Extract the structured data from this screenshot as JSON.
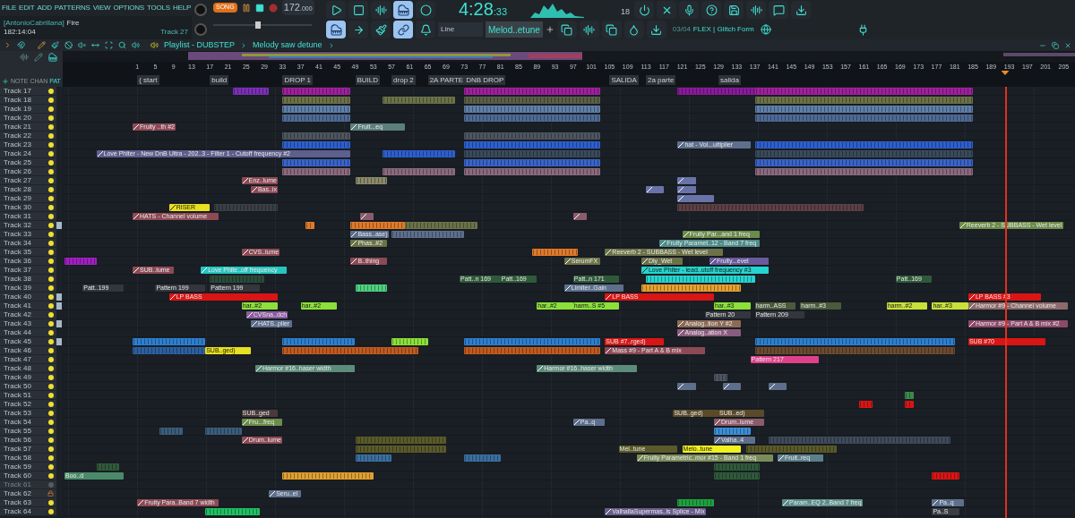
{
  "menu": [
    "FILE",
    "EDIT",
    "ADD",
    "PATTERNS",
    "VIEW",
    "OPTIONS",
    "TOOLS",
    "HELP"
  ],
  "transport": {
    "mode": "SONG",
    "recording": false,
    "tempo": "172",
    "tempo_fraction": ".000",
    "time": "4:28",
    "time_fraction": ":33",
    "voices": "18"
  },
  "pitch": {
    "level": 0.45
  },
  "hint": {
    "user": "[AntonioCabrillana]",
    "title": "Fire",
    "position": "182:14:04",
    "track": "Track 27"
  },
  "tools": [
    {
      "kind": "piano",
      "selected": true
    },
    {
      "kind": "arrow",
      "selected": false
    },
    {
      "kind": "brush",
      "selected": false
    },
    {
      "kind": "link",
      "selected": true
    },
    {
      "kind": "bell",
      "selected": false
    }
  ],
  "snap": "Line",
  "pattern": "Melod..etune",
  "news": {
    "counter": "03/04",
    "text": "FLEX | Glitch Form"
  },
  "playlist": {
    "title": "Playlist - DUBSTEP",
    "pattern": "Melody saw detune"
  },
  "view_tabs": [
    {
      "label": "NOTE",
      "selected": false
    },
    {
      "label": "CHAN",
      "selected": false
    },
    {
      "label": "PAT",
      "selected": true
    }
  ],
  "ruler": [
    "1",
    "5",
    "9",
    "13",
    "17",
    "21",
    "25",
    "29",
    "33",
    "37",
    "41",
    "45",
    "49",
    "53",
    "57",
    "61",
    "65",
    "69",
    "73",
    "77",
    "81",
    "85",
    "89",
    "93",
    "97",
    "101",
    "105",
    "109",
    "113",
    "117",
    "121",
    "125",
    "129",
    "133",
    "137",
    "141",
    "145",
    "149",
    "153",
    "157",
    "161",
    "165",
    "169",
    "173",
    "177",
    "181",
    "185",
    "189",
    "193",
    "197",
    "201",
    "205"
  ],
  "markers": [
    "( start",
    "build",
    "DROP 1",
    "BUILD",
    "drop 2",
    "2A PARTE",
    "DNB DROP",
    "SALIDA",
    "2a parte",
    "salida"
  ],
  "tracks": [
    {
      "name": "Track 17",
      "enabled": true,
      "locked": false,
      "marked": false,
      "clips": [
        {
          "kind": "pattern",
          "color": "#7a2fb5"
        },
        {
          "kind": "pattern",
          "color": "#a0209e"
        },
        {
          "kind": "pattern",
          "color": "#a0209e"
        },
        {
          "kind": "pattern",
          "color": "#8a1a9a"
        },
        {
          "kind": "pattern",
          "color": "#a0209e"
        }
      ]
    },
    {
      "name": "Track 18",
      "enabled": true,
      "locked": false,
      "marked": false,
      "clips": [
        {
          "kind": "pattern",
          "color": "#6b7248"
        },
        {
          "kind": "pattern",
          "color": "#6b7248"
        },
        {
          "kind": "pattern",
          "color": "#5a5f48"
        },
        {
          "kind": "pattern",
          "color": "#6b7248"
        }
      ]
    },
    {
      "name": "Track 19",
      "enabled": true,
      "locked": false,
      "marked": false,
      "clips": [
        {
          "kind": "pattern",
          "color": "#5f7fa8"
        },
        {
          "kind": "pattern",
          "color": "#5f7fa8"
        },
        {
          "kind": "pattern",
          "color": "#5f7fa8"
        }
      ]
    },
    {
      "name": "Track 20",
      "enabled": true,
      "locked": false,
      "marked": false,
      "clips": [
        {
          "kind": "pattern",
          "color": "#4e6a96"
        },
        {
          "kind": "pattern",
          "color": "#4e6a96"
        },
        {
          "kind": "pattern",
          "color": "#4e6a96"
        }
      ]
    },
    {
      "name": "Track 21",
      "enabled": true,
      "locked": false,
      "marked": false,
      "clips": [
        {
          "kind": "automation",
          "label": "Fruity ..th #2",
          "color": "#8c4a55"
        },
        {
          "kind": "automation",
          "label": "Fruit...eq",
          "color": "#5d7f7a"
        }
      ]
    },
    {
      "name": "Track 22",
      "enabled": true,
      "locked": false,
      "marked": false,
      "clips": [
        {
          "kind": "pattern",
          "color": "#4d5560"
        },
        {
          "kind": "pattern",
          "color": "#4d5560"
        }
      ]
    },
    {
      "name": "Track 23",
      "enabled": true,
      "locked": false,
      "marked": false,
      "clips": [
        {
          "kind": "pattern",
          "color": "#2d5fcf"
        },
        {
          "kind": "pattern",
          "color": "#2d5fcf"
        },
        {
          "kind": "automation",
          "label": "hat - Vol...ultiplier",
          "color": "#5d6f8c"
        },
        {
          "kind": "pattern",
          "color": "#2d5fcf"
        }
      ]
    },
    {
      "name": "Track 24",
      "enabled": true,
      "locked": false,
      "marked": false,
      "clips": [
        {
          "kind": "automation",
          "label": "Love Phlter - New DnB Ultra - 202..3 - Filter 1 - Cutoff frequency #2",
          "color": "#5d5f8c"
        },
        {
          "kind": "pattern",
          "color": "#2d5fcf"
        },
        {
          "kind": "pattern",
          "color": "#3a4a5a"
        },
        {
          "kind": "pattern",
          "color": "#3a4a5a"
        }
      ]
    },
    {
      "name": "Track 25",
      "enabled": true,
      "locked": false,
      "marked": false,
      "clips": [
        {
          "kind": "pattern",
          "color": "#3a63c9"
        },
        {
          "kind": "pattern",
          "color": "#3a63c9"
        },
        {
          "kind": "pattern",
          "color": "#3a63c9"
        }
      ]
    },
    {
      "name": "Track 26",
      "enabled": true,
      "locked": false,
      "marked": false,
      "clips": [
        {
          "kind": "pattern",
          "color": "#8a6a7e"
        },
        {
          "kind": "pattern",
          "color": "#8a6a7e"
        },
        {
          "kind": "pattern",
          "color": "#8a6a7e"
        },
        {
          "kind": "pattern",
          "color": "#8a6a7e"
        }
      ]
    },
    {
      "name": "Track 27",
      "enabled": true,
      "locked": false,
      "marked": false,
      "clips": [
        {
          "kind": "automation",
          "label": "Enz..lume",
          "color": "#8c4a55"
        },
        {
          "kind": "pattern",
          "color": "#8a8a6a"
        },
        {
          "kind": "automation",
          "color": "#6a73a8"
        }
      ]
    },
    {
      "name": "Track 28",
      "enabled": true,
      "locked": false,
      "marked": false,
      "clips": [
        {
          "kind": "automation",
          "label": "Bas..ix",
          "color": "#8c4a55"
        },
        {
          "kind": "automation",
          "color": "#6a73a8"
        },
        {
          "kind": "automation",
          "color": "#6a73a8"
        }
      ]
    },
    {
      "name": "Track 29",
      "enabled": true,
      "locked": false,
      "marked": false,
      "clips": [
        {
          "kind": "automation",
          "color": "#6a73a8"
        }
      ]
    },
    {
      "name": "Track 30",
      "enabled": true,
      "locked": false,
      "marked": false,
      "clips": [
        {
          "kind": "automation",
          "label": "RISER",
          "color": "#e8e020"
        },
        {
          "kind": "pattern",
          "color": "#3a3f46"
        },
        {
          "kind": "pattern",
          "color": "#5b4045"
        }
      ]
    },
    {
      "name": "Track 31",
      "enabled": true,
      "locked": false,
      "marked": false,
      "clips": [
        {
          "kind": "automation",
          "label": "HATS - Channel volume",
          "color": "#8c4a55"
        },
        {
          "kind": "automation",
          "color": "#8a5c6e"
        },
        {
          "kind": "automation",
          "color": "#8a5c6e"
        }
      ]
    },
    {
      "name": "Track 32",
      "enabled": true,
      "locked": false,
      "marked": true,
      "clips": [
        {
          "kind": "pattern",
          "color": "#e07a2a"
        },
        {
          "kind": "pattern",
          "color": "#e07a2a"
        },
        {
          "kind": "pattern",
          "color": "#6b7248"
        },
        {
          "kind": "automation",
          "label": "Reeverb 2 - SUBBASS - Wet level",
          "color": "#6b8c4a"
        }
      ]
    },
    {
      "name": "Track 33",
      "enabled": true,
      "locked": false,
      "marked": false,
      "clips": [
        {
          "kind": "automation",
          "label": "Bass..ase)",
          "color": "#5d6f8c"
        },
        {
          "kind": "pattern",
          "color": "#5d6f8c"
        },
        {
          "kind": "automation",
          "label": "Fruity Par...and 1 freq",
          "color": "#6b8c4a"
        }
      ]
    },
    {
      "name": "Track 34",
      "enabled": true,
      "locked": false,
      "marked": false,
      "clips": [
        {
          "kind": "automation",
          "label": "Phas..#2",
          "color": "#6b7248"
        },
        {
          "kind": "automation",
          "label": "Fruity Paramet..12 - Band 7 freq",
          "color": "#4f8c8a"
        }
      ]
    },
    {
      "name": "Track 35",
      "enabled": true,
      "locked": false,
      "marked": false,
      "clips": [
        {
          "kind": "automation",
          "label": "CVS..lume",
          "color": "#8c4a55"
        },
        {
          "kind": "pattern",
          "color": "#e07a2a"
        },
        {
          "kind": "automation",
          "label": "Reeverb 2 - SUBBASS - Wet level",
          "color": "#6b7248"
        }
      ]
    },
    {
      "name": "Track 36",
      "enabled": true,
      "locked": false,
      "marked": false,
      "clips": [
        {
          "kind": "pattern",
          "color": "#a020c0"
        },
        {
          "kind": "automation",
          "label": "B..thing",
          "color": "#8c4a55"
        },
        {
          "kind": "automation",
          "label": "SerumFX",
          "color": "#6b7248"
        },
        {
          "kind": "automation",
          "label": "Dly_Wet",
          "color": "#6b7248"
        },
        {
          "kind": "automation",
          "label": "Fruity...evel",
          "color": "#6a5a9c"
        }
      ]
    },
    {
      "name": "Track 37",
      "enabled": true,
      "locked": false,
      "marked": false,
      "clips": [
        {
          "kind": "automation",
          "label": "SUB..lume",
          "color": "#8c4a55"
        },
        {
          "kind": "automation",
          "label": "Love Phlte..off frequency",
          "color": "#25c5c0"
        },
        {
          "kind": "automation",
          "label": "Love Phlter - lead..utoff frequency #3",
          "color": "#25d5cf"
        }
      ]
    },
    {
      "name": "Track 38",
      "enabled": true,
      "locked": false,
      "marked": false,
      "clips": [
        {
          "kind": "pattern",
          "color": "#2a4a3a"
        },
        {
          "kind": "pattern",
          "label": "Patt..n 169",
          "color": "#2f5a3a"
        },
        {
          "kind": "pattern",
          "label": "Patt..169",
          "color": "#2f5a3a"
        },
        {
          "kind": "pattern",
          "label": "Patt..n 171",
          "color": "#2f5a3a"
        },
        {
          "kind": "pattern",
          "color": "#25d5cf"
        },
        {
          "kind": "pattern",
          "label": "Patt..169",
          "color": "#2f5a3a"
        }
      ]
    },
    {
      "name": "Track 39",
      "enabled": true,
      "locked": false,
      "marked": false,
      "clips": [
        {
          "kind": "pattern",
          "label": "Patt..199",
          "color": "#33363d"
        },
        {
          "kind": "pattern",
          "label": "Pattern 199",
          "color": "#33363d"
        },
        {
          "kind": "pattern",
          "label": "Pattern 199",
          "color": "#33363d"
        },
        {
          "kind": "pattern",
          "color": "#4fd080"
        },
        {
          "kind": "automation",
          "label": "Limiter..Gain",
          "color": "#5d6f8c"
        },
        {
          "kind": "pattern",
          "color": "#e8a030"
        }
      ]
    },
    {
      "name": "Track 40",
      "enabled": true,
      "locked": false,
      "marked": true,
      "clips": [
        {
          "kind": "automation",
          "label": "LP BASS",
          "color": "#d91515"
        },
        {
          "kind": "automation",
          "label": "LP BASS",
          "color": "#d91515"
        },
        {
          "kind": "automation",
          "label": "LP BASS #3",
          "color": "#d91515"
        }
      ]
    },
    {
      "name": "Track 41",
      "enabled": true,
      "locked": false,
      "marked": true,
      "clips": [
        {
          "kind": "pattern",
          "label": "har..#2",
          "color": "#8be03a"
        },
        {
          "kind": "pattern",
          "label": "har..#2",
          "color": "#8be03a"
        },
        {
          "kind": "pattern",
          "label": "har..#2",
          "color": "#8be03a"
        },
        {
          "kind": "pattern",
          "label": "harm..S #5",
          "color": "#8be03a"
        },
        {
          "kind": "pattern",
          "label": "har..#3",
          "color": "#8be03a"
        },
        {
          "kind": "pattern",
          "label": "harm..ASS",
          "color": "#4a5a3a"
        },
        {
          "kind": "pattern",
          "label": "harm..#3",
          "color": "#4a5a3a"
        },
        {
          "kind": "pattern",
          "label": "harm..#2",
          "color": "#c8e03a"
        },
        {
          "kind": "pattern",
          "label": "har..#3",
          "color": "#c8e03a"
        },
        {
          "kind": "automation",
          "label": "Harmor #9 - Channel volume",
          "color": "#8c6a6a"
        }
      ]
    },
    {
      "name": "Track 42",
      "enabled": true,
      "locked": false,
      "marked": false,
      "clips": [
        {
          "kind": "automation",
          "label": "CVSna..dch",
          "color": "#8a5c9e"
        },
        {
          "kind": "pattern",
          "label": "Pattern 20",
          "color": "#33363d"
        },
        {
          "kind": "pattern",
          "label": "Pattern 209",
          "color": "#33363d"
        }
      ]
    },
    {
      "name": "Track 43",
      "enabled": true,
      "locked": false,
      "marked": true,
      "clips": [
        {
          "kind": "automation",
          "label": "HATS..plier",
          "color": "#5d6f8c"
        },
        {
          "kind": "automation",
          "label": "Analog..tion Y #2",
          "color": "#8c6a55"
        },
        {
          "kind": "automation",
          "label": "Harmor #9 - Part A & B mix #2",
          "color": "#8c4a6a"
        }
      ]
    },
    {
      "name": "Track 44",
      "enabled": true,
      "locked": false,
      "marked": false,
      "clips": [
        {
          "kind": "automation",
          "label": "Analog..ation X",
          "color": "#8a5c7e"
        }
      ]
    },
    {
      "name": "Track 45",
      "enabled": true,
      "locked": false,
      "marked": true,
      "clips": [
        {
          "kind": "pattern",
          "color": "#2d7fd0"
        },
        {
          "kind": "pattern",
          "color": "#2d7fd0"
        },
        {
          "kind": "pattern",
          "color": "#8be03a"
        },
        {
          "kind": "pattern",
          "color": "#2d7fd0"
        },
        {
          "kind": "pattern",
          "label": "SUB #7..rged)",
          "color": "#d91515"
        },
        {
          "kind": "pattern",
          "color": "#2d7fd0"
        },
        {
          "kind": "pattern",
          "label": "SUB #70",
          "color": "#d91515"
        }
      ]
    },
    {
      "name": "Track 46",
      "enabled": true,
      "locked": false,
      "marked": false,
      "clips": [
        {
          "kind": "pattern",
          "color": "#2d5f9f"
        },
        {
          "kind": "pattern",
          "label": "SUB..ged)",
          "color": "#e8e020"
        },
        {
          "kind": "pattern",
          "color": "#c05a20"
        },
        {
          "kind": "pattern",
          "color": "#c05a20"
        },
        {
          "kind": "automation",
          "label": "Mass #9 - Part A & B mix",
          "color": "#8c4a55"
        },
        {
          "kind": "pattern",
          "color": "#6b4a30"
        }
      ]
    },
    {
      "name": "Track 47",
      "enabled": true,
      "locked": false,
      "marked": false,
      "clips": [
        {
          "kind": "pattern",
          "label": "Pattern 217",
          "color": "#e0408a"
        }
      ]
    },
    {
      "name": "Track 48",
      "enabled": true,
      "locked": false,
      "marked": false,
      "clips": [
        {
          "kind": "automation",
          "label": "Harmor #16..haser width",
          "color": "#5d8c7a"
        },
        {
          "kind": "automation",
          "label": "Harmor #16..haser width",
          "color": "#5d8c7a"
        }
      ]
    },
    {
      "name": "Track 49",
      "enabled": true,
      "locked": false,
      "marked": false,
      "clips": [
        {
          "kind": "pattern",
          "color": "#4d5560"
        }
      ]
    },
    {
      "name": "Track 50",
      "enabled": true,
      "locked": false,
      "marked": false,
      "clips": [
        {
          "kind": "automation",
          "color": "#5d6f8c"
        },
        {
          "kind": "automation",
          "color": "#5d6f8c"
        },
        {
          "kind": "automation",
          "color": "#5d6f8c"
        }
      ]
    },
    {
      "name": "Track 51",
      "enabled": true,
      "locked": false,
      "marked": false,
      "clips": [
        {
          "kind": "pattern",
          "color": "#3a8a4a"
        }
      ]
    },
    {
      "name": "Track 52",
      "enabled": true,
      "locked": false,
      "marked": false,
      "clips": [
        {
          "kind": "pattern",
          "color": "#d91515"
        },
        {
          "kind": "pattern",
          "color": "#d91515"
        }
      ]
    },
    {
      "name": "Track 53",
      "enabled": true,
      "locked": false,
      "marked": false,
      "clips": [
        {
          "kind": "pattern",
          "label": "SUB..ged",
          "color": "#4a3a3a"
        },
        {
          "kind": "pattern",
          "label": "SUB..ged)",
          "color": "#5a4a2a"
        },
        {
          "kind": "pattern",
          "label": "SUB..ed)",
          "color": "#5a4a2a"
        }
      ]
    },
    {
      "name": "Track 54",
      "enabled": true,
      "locked": false,
      "marked": false,
      "clips": [
        {
          "kind": "automation",
          "label": "Fru...freq",
          "color": "#6b8c4a"
        },
        {
          "kind": "automation",
          "label": "Pa..q",
          "color": "#5d6f8c"
        },
        {
          "kind": "automation",
          "label": "Drum..lume",
          "color": "#8c5a6a"
        }
      ]
    },
    {
      "name": "Track 55",
      "enabled": true,
      "locked": false,
      "marked": false,
      "clips": [
        {
          "kind": "pattern",
          "color": "#3a5d7a"
        },
        {
          "kind": "pattern",
          "color": "#3a5d7a"
        },
        {
          "kind": "pattern",
          "color": "#3a8fd8"
        }
      ]
    },
    {
      "name": "Track 56",
      "enabled": true,
      "locked": false,
      "marked": false,
      "clips": [
        {
          "kind": "automation",
          "label": "Drum..lume",
          "color": "#8c4a55"
        },
        {
          "kind": "pattern",
          "color": "#5a5a2a"
        },
        {
          "kind": "automation",
          "label": "Valha..4",
          "color": "#5d6f8c"
        },
        {
          "kind": "pattern",
          "color": "#3f4a5a"
        }
      ]
    },
    {
      "name": "Track 57",
      "enabled": true,
      "locked": false,
      "marked": false,
      "clips": [
        {
          "kind": "pattern",
          "color": "#5a5a2a"
        },
        {
          "kind": "pattern",
          "label": "Mel..tune",
          "color": "#5a5a2a"
        },
        {
          "kind": "pattern",
          "label": "Melo..tune",
          "color": "#f0f020"
        },
        {
          "kind": "pattern",
          "color": "#5a5a2a"
        }
      ]
    },
    {
      "name": "Track 58",
      "enabled": true,
      "locked": false,
      "marked": false,
      "clips": [
        {
          "kind": "pattern",
          "color": "#3a6f9f"
        },
        {
          "kind": "pattern",
          "color": "#3a6f9f"
        },
        {
          "kind": "automation",
          "label": "Fruity Parametric..mor #15 - Band 1 freq",
          "color": "#7a8c5a"
        },
        {
          "kind": "automation",
          "label": "Fruit..req",
          "color": "#5d7f8a"
        }
      ]
    },
    {
      "name": "Track 59",
      "enabled": true,
      "locked": false,
      "marked": false,
      "clips": [
        {
          "kind": "pattern",
          "color": "#2f5a3a"
        },
        {
          "kind": "pattern",
          "color": "#2f5a3a"
        }
      ]
    },
    {
      "name": "Track 60",
      "enabled": true,
      "locked": false,
      "marked": false,
      "clips": [
        {
          "kind": "pattern",
          "label": "Boo..d",
          "color": "#4a8a6a"
        },
        {
          "kind": "pattern",
          "color": "#e0a030"
        },
        {
          "kind": "pattern",
          "color": "#2f5a3a"
        },
        {
          "kind": "pattern",
          "color": "#d91515"
        }
      ]
    },
    {
      "name": "Track 61",
      "enabled": false,
      "locked": false,
      "marked": false
    },
    {
      "name": "Track 62",
      "enabled": true,
      "locked": true,
      "marked": false,
      "clips": [
        {
          "kind": "automation",
          "label": "Seru..el",
          "color": "#5d6f8c"
        }
      ]
    },
    {
      "name": "Track 63",
      "enabled": true,
      "locked": false,
      "marked": false,
      "clips": [
        {
          "kind": "automation",
          "label": "Fruity Para..Band 7 width",
          "color": "#8c4a55"
        },
        {
          "kind": "pattern",
          "color": "#20a040"
        },
        {
          "kind": "automation",
          "label": "Param..EQ 2..Band 7 freq",
          "color": "#5d8c8a"
        },
        {
          "kind": "automation",
          "label": "Pa..q",
          "color": "#5d6f8c"
        }
      ]
    },
    {
      "name": "Track 64",
      "enabled": true,
      "locked": false,
      "marked": false,
      "clips": [
        {
          "kind": "pattern",
          "color": "#20c060"
        },
        {
          "kind": "automation",
          "label": "ValhallaSupermas..ls Splice - Mix",
          "color": "#6a5d8c"
        },
        {
          "kind": "pattern",
          "label": "Pa..S",
          "color": "#3a3d44"
        }
      ]
    }
  ]
}
